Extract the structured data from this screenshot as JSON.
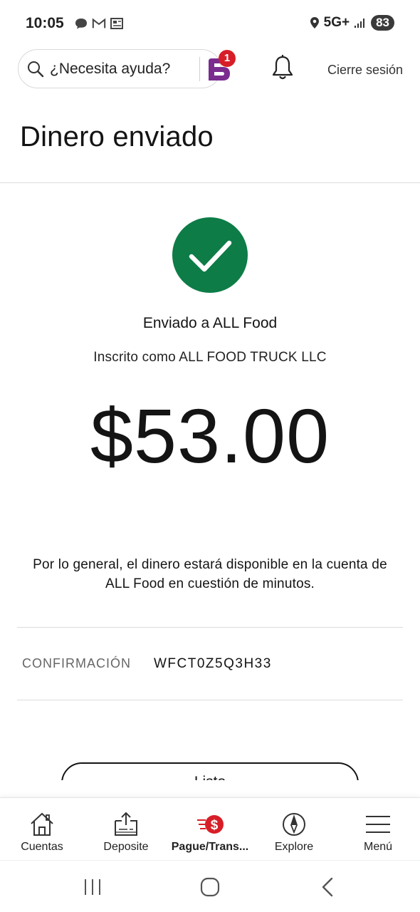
{
  "status_bar": {
    "time": "10:05",
    "network": "5G+",
    "battery": "83"
  },
  "header": {
    "help_text": "¿Necesita ayuda?",
    "notification_badge": "1",
    "logout_label": "Cierre sesión"
  },
  "page": {
    "title": "Dinero enviado",
    "sent_to": "Enviado a ALL Food",
    "registered_as": "Inscrito como ALL FOOD TRUCK LLC",
    "amount": "$53.00",
    "availability_note": "Por lo general, el dinero estará disponible en la cuenta de ALL Food en cuestión de minutos.",
    "confirmation_label": "CONFIRMACIÓN",
    "confirmation_number": "WFCT0Z5Q3H33",
    "done_label": "Listo"
  },
  "bottom_nav": {
    "items": [
      {
        "label": "Cuentas",
        "icon": "house-icon"
      },
      {
        "label": "Deposite",
        "icon": "deposit-icon"
      },
      {
        "label": "Pague/Trans...",
        "icon": "pay-transfer-icon",
        "active": true
      },
      {
        "label": "Explore",
        "icon": "compass-icon"
      },
      {
        "label": "Menú",
        "icon": "menu-icon"
      }
    ]
  },
  "colors": {
    "success_green": "#0d7c47",
    "brand_red": "#d71e28",
    "fargo_purple": "#6b2c8f"
  }
}
